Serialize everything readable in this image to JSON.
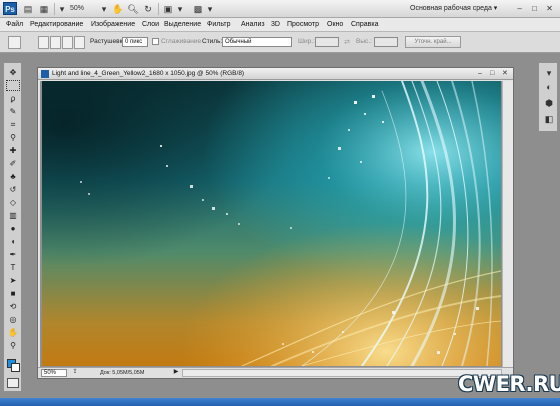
{
  "titlebar": {
    "app_logo": "Ps",
    "zoom": "50%",
    "workspace": "Основная рабочая среда ▾",
    "controls": [
      "–",
      "□",
      "✕"
    ]
  },
  "menu": [
    "Файл",
    "Редактирование",
    "Изображение",
    "Слои",
    "Выделение",
    "Фильтр",
    "Анализ",
    "3D",
    "Просмотр",
    "Окно",
    "Справка"
  ],
  "options": {
    "feather_label": "Растушевка:",
    "feather_value": "0 пикс",
    "antialias_label": "Сглаживание",
    "style_label": "Стиль:",
    "style_value": "Обычный",
    "width_label": "Шир.:",
    "height_label": "Выс.:",
    "refine_button": "Уточн. край..."
  },
  "document": {
    "title": "Light and line_4_Green_Yellow2_1680 x 1050.jpg @ 50% (RGB/8)",
    "zoom": "50%",
    "doc_info": "Док: 5,05M/5,05M"
  },
  "watermark": "CWER.RU",
  "colors": {
    "foreground": "#1e8fe0",
    "background": "#ffffff"
  }
}
